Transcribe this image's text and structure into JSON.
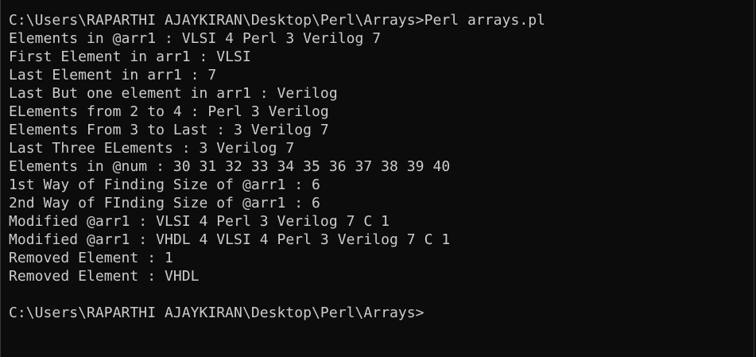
{
  "terminal": {
    "command_prompt": "C:\\Users\\RAPARTHI AJAYKIRAN\\Desktop\\Perl\\Arrays>Perl arrays.pl",
    "output": [
      "Elements in @arr1 : VLSI 4 Perl 3 Verilog 7",
      "First Element in arr1 : VLSI",
      "Last Element in arr1 : 7",
      "Last But one element in arr1 : Verilog",
      "ELements from 2 to 4 : Perl 3 Verilog",
      "Elements From 3 to Last : 3 Verilog 7",
      "Last Three ELements : 3 Verilog 7",
      "Elements in @num : 30 31 32 33 34 35 36 37 38 39 40",
      "1st Way of Finding Size of @arr1 : 6",
      "2nd Way of FInding Size of @arr1 : 6",
      "Modified @arr1 : VLSI 4 Perl 3 Verilog 7 C 1",
      "Modified @arr1 : VHDL 4 VLSI 4 Perl 3 Verilog 7 C 1",
      "Removed Element : 1",
      "Removed Element : VHDL"
    ],
    "final_prompt": "C:\\Users\\RAPARTHI AJAYKIRAN\\Desktop\\Perl\\Arrays>"
  },
  "colors": {
    "background": "#0c0c0c",
    "foreground": "#cccccc"
  }
}
